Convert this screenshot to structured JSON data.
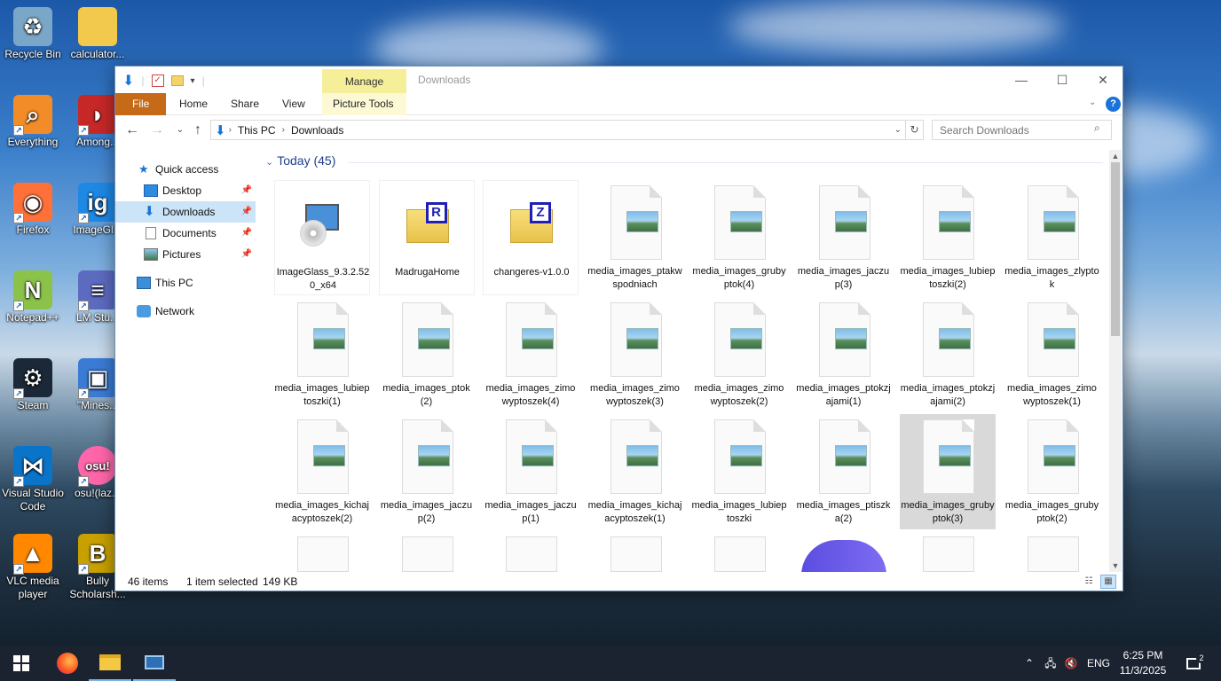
{
  "desktop": {
    "icons": [
      {
        "label": "Recycle Bin",
        "icon": "recycle-bin-icon"
      },
      {
        "label": "calculator...",
        "icon": "folder-icon"
      },
      {
        "label": "Everything",
        "icon": "search-magnifier-icon"
      },
      {
        "label": "Among...",
        "icon": "among-us-icon"
      },
      {
        "label": "Firefox",
        "icon": "firefox-icon"
      },
      {
        "label": "ImageGl...",
        "icon": "imageglass-icon"
      },
      {
        "label": "Notepad++",
        "icon": "notepadpp-icon"
      },
      {
        "label": "LM Stu...",
        "icon": "lmstudio-icon"
      },
      {
        "label": "Steam",
        "icon": "steam-icon"
      },
      {
        "label": "\"Mines...",
        "icon": "minesweeper-icon"
      },
      {
        "label": "Visual Studio Code",
        "icon": "vscode-icon"
      },
      {
        "label": "osu!(laz...",
        "icon": "osu-icon"
      },
      {
        "label": "VLC media player",
        "icon": "vlc-icon"
      },
      {
        "label": "Bully Scholarsh...",
        "icon": "bully-icon"
      }
    ]
  },
  "window": {
    "title": "Downloads",
    "manage_tab": "Manage",
    "ribbon_tabs": [
      "File",
      "Home",
      "Share",
      "View",
      "Picture Tools"
    ],
    "controls": {
      "minimize": "—",
      "maximize": "☐",
      "close": "✕"
    }
  },
  "address": {
    "crumbs": [
      "This PC",
      "Downloads"
    ],
    "search_placeholder": "Search Downloads"
  },
  "nav": {
    "quick_access": "Quick access",
    "items": [
      "Desktop",
      "Downloads",
      "Documents",
      "Pictures"
    ],
    "this_pc": "This PC",
    "network": "Network"
  },
  "content": {
    "group_header": "Today (45)",
    "items": [
      {
        "name": "ImageGlass_9.3.2.520_x64",
        "type": "installer"
      },
      {
        "name": "MadrugaHome",
        "type": "archive-r"
      },
      {
        "name": "changeres-v1.0.0",
        "type": "archive-z"
      },
      {
        "name": "media_images_ptakwspodniach",
        "type": "image"
      },
      {
        "name": "media_images_grubyptok(4)",
        "type": "image"
      },
      {
        "name": "media_images_jaczup(3)",
        "type": "image"
      },
      {
        "name": "media_images_lubieptoszki(2)",
        "type": "image"
      },
      {
        "name": "media_images_zlyptok",
        "type": "image"
      },
      {
        "name": "media_images_lubieptoszki(1)",
        "type": "image"
      },
      {
        "name": "media_images_ptok(2)",
        "type": "image"
      },
      {
        "name": "media_images_zimowyptoszek(4)",
        "type": "image"
      },
      {
        "name": "media_images_zimowyptoszek(3)",
        "type": "image"
      },
      {
        "name": "media_images_zimowyptoszek(2)",
        "type": "image"
      },
      {
        "name": "media_images_ptokzjajami(1)",
        "type": "image"
      },
      {
        "name": "media_images_ptokzjajami(2)",
        "type": "image"
      },
      {
        "name": "media_images_zimowyptoszek(1)",
        "type": "image"
      },
      {
        "name": "media_images_kichajacyptoszek(2)",
        "type": "image"
      },
      {
        "name": "media_images_jaczup(2)",
        "type": "image"
      },
      {
        "name": "media_images_jaczup(1)",
        "type": "image"
      },
      {
        "name": "media_images_kichajacyptoszek(1)",
        "type": "image"
      },
      {
        "name": "media_images_lubieptoszki",
        "type": "image"
      },
      {
        "name": "media_images_ptiszka(2)",
        "type": "image"
      },
      {
        "name": "media_images_grubyptok(3)",
        "type": "image",
        "selected": true
      },
      {
        "name": "media_images_grubyptok(2)",
        "type": "image"
      }
    ]
  },
  "status": {
    "count": "46 items",
    "selected": "1 item selected",
    "size": "149 KB"
  },
  "taskbar": {
    "language": "ENG",
    "time": "6:25 PM",
    "date": "11/3/2025",
    "notifications": "2"
  }
}
